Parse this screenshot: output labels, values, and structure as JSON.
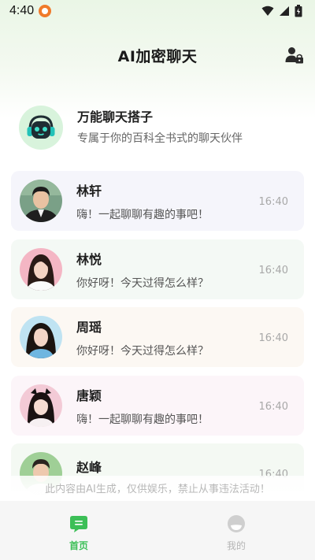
{
  "status_bar": {
    "time": "4:40",
    "app_icon": "app-notification-icon",
    "wifi_icon": "wifi-icon",
    "signal_icon": "cellular-signal-icon",
    "battery_icon": "battery-icon"
  },
  "header": {
    "title": "AI加密聊天",
    "user_button_icon": "user-lock-icon"
  },
  "featured": {
    "name": "万能聊天搭子",
    "description": "专属于你的百科全书式的聊天伙伴",
    "avatar_icon": "robot-headphones-icon"
  },
  "chats": [
    {
      "name": "林轩",
      "message": "嗨！一起聊聊有趣的事吧！",
      "time": "16:40",
      "bg": "#f5f5fb"
    },
    {
      "name": "林悦",
      "message": "你好呀！今天过得怎么样？",
      "time": "16:40",
      "bg": "#f4f9f5"
    },
    {
      "name": "周瑶",
      "message": "你好呀！今天过得怎么样？",
      "time": "16:40",
      "bg": "#fcf8f3"
    },
    {
      "name": "唐颖",
      "message": "嗨！一起聊聊有趣的事吧！",
      "time": "16:40",
      "bg": "#fcf5f9"
    },
    {
      "name": "赵峰",
      "message": "",
      "time": "16:40",
      "bg": "#f4f9f3"
    }
  ],
  "disclaimer": "此内容由AI生成，仅供娱乐，禁止从事违法活动！",
  "tabbar": {
    "tabs": [
      {
        "label": "首页",
        "icon": "chat-bubble-icon",
        "active": true
      },
      {
        "label": "我的",
        "icon": "profile-icon",
        "active": false
      }
    ]
  },
  "colors": {
    "accent": "#3cbf57",
    "header_gradient": "#eaf6e6"
  }
}
